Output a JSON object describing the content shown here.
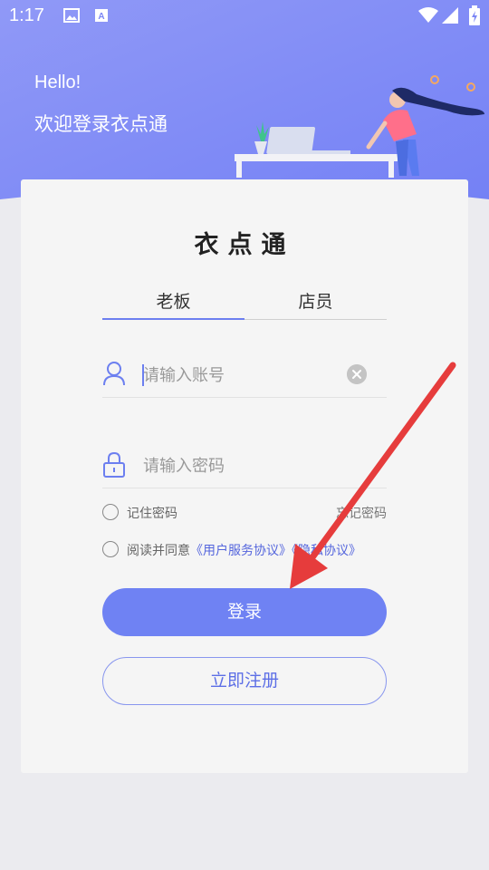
{
  "status_bar": {
    "time": "1:17",
    "icons": [
      "image-icon",
      "a-letter-icon",
      "wifi-icon",
      "signal-icon",
      "battery-charging-icon"
    ]
  },
  "header": {
    "hello": "Hello!",
    "welcome": "欢迎登录衣点通"
  },
  "card": {
    "logo_text": "衣点通",
    "tabs": [
      {
        "label": "老板",
        "active": true
      },
      {
        "label": "店员",
        "active": false
      }
    ],
    "account_field": {
      "placeholder": "请输入账号",
      "value": ""
    },
    "password_field": {
      "placeholder": "请输入密码",
      "value": ""
    },
    "remember_label": "记住密码",
    "forgot_label": "忘记密码",
    "agree_prefix": "阅读并同意",
    "user_agreement": "《用户服务协议》",
    "privacy_policy": "《隐私协议》",
    "login_label": "登录",
    "register_label": "立即注册"
  },
  "colors": {
    "accent": "#6f82f3",
    "header_gradient_start": "#8d97f7",
    "header_gradient_end": "#7a86f5",
    "annotation_arrow": "#e63c3c"
  }
}
